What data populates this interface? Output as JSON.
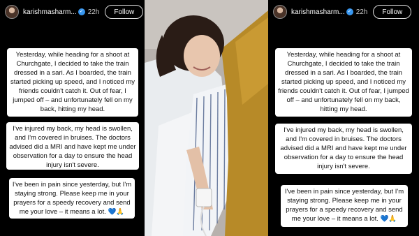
{
  "story": {
    "username": "karishmasharm...",
    "time": "22h",
    "follow_label": "Follow",
    "paragraphs": [
      "Yesterday, while heading for a shoot at Churchgate, I decided to take the train dressed in a sari. As I boarded, the train started picking up speed, and I noticed my friends couldn't catch it. Out of fear, I jumped off – and unfortunately fell on my back, hitting my head.",
      "I've injured my back, my head is swollen, and I'm covered in bruises. The doctors advised did a MRI and have kept me under observation for a day to ensure the head injury isn't severe.",
      "I've been in pain since yesterday, but I'm staying strong. Please keep me in your prayers for a speedy recovery and send me your love – it means a lot. 💙🙏"
    ]
  },
  "icons": [
    "verified-badge-icon",
    "profile-avatar-icon"
  ],
  "colors": {
    "background": "#000000",
    "card": "#ffffff",
    "verified": "#3897f0"
  }
}
